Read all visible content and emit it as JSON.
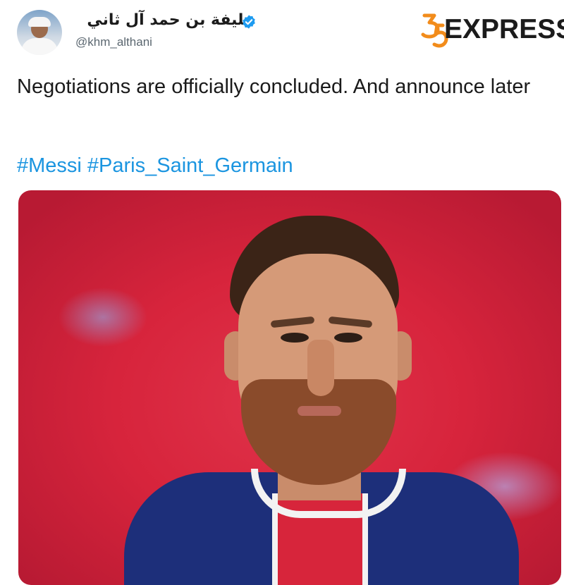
{
  "tweet": {
    "display_name": "خليفة بن حمد آل ثاني",
    "handle": "@khm_althani",
    "text": "Negotiations are officially concluded. And announce later",
    "hashtags": [
      "#Messi",
      "#Paris_Saint_Germain"
    ]
  },
  "watermark": {
    "brand": "EXPRESS",
    "mark": "35"
  },
  "icons": {
    "verified": "verified-badge-icon",
    "logo": "express-logo-icon"
  },
  "colors": {
    "hashtag": "#1b95e0",
    "verified": "#1d9bf0",
    "logo_accent": "#f28c1b",
    "photo_background": "#d7243c"
  }
}
